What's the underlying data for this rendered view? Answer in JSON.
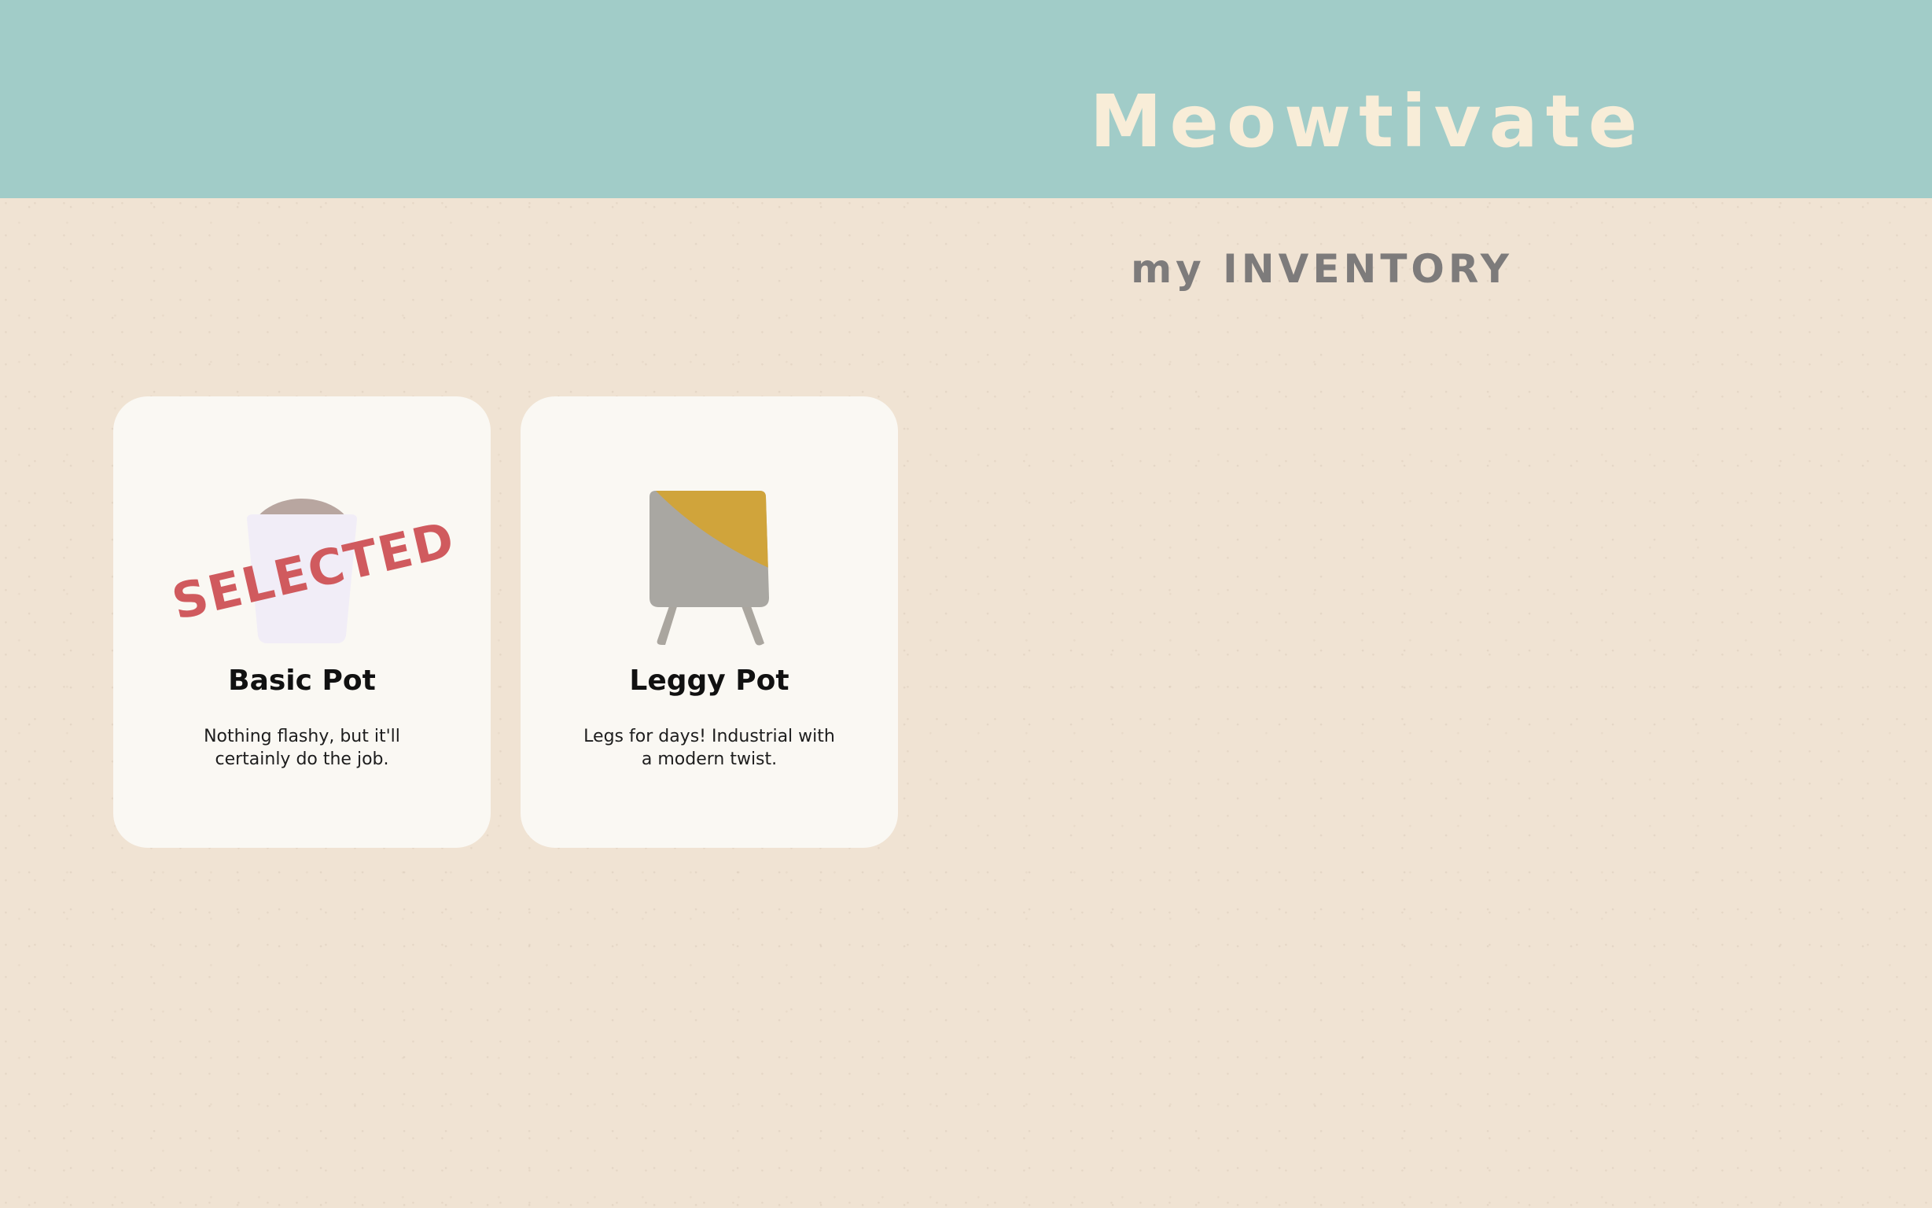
{
  "app": {
    "title": "Meowtivate"
  },
  "page": {
    "section_title": "my INVENTORY"
  },
  "colors": {
    "header_bg": "#a1ccc8",
    "brand_text": "#f8edd8",
    "page_bg": "#f0e3d3",
    "card_bg": "#faf8f3",
    "stamp": "#d05a5e",
    "section_title": "#7d7b7b"
  },
  "inventory": {
    "items": [
      {
        "name": "Basic Pot",
        "description": "Nothing flashy, but it'll certainly do the job.",
        "status": "SELECTED",
        "icon": "basic-pot-icon"
      },
      {
        "name": "Leggy Pot",
        "description": "Legs for days! Industrial with a modern twist.",
        "icon": "leggy-pot-icon"
      }
    ]
  }
}
